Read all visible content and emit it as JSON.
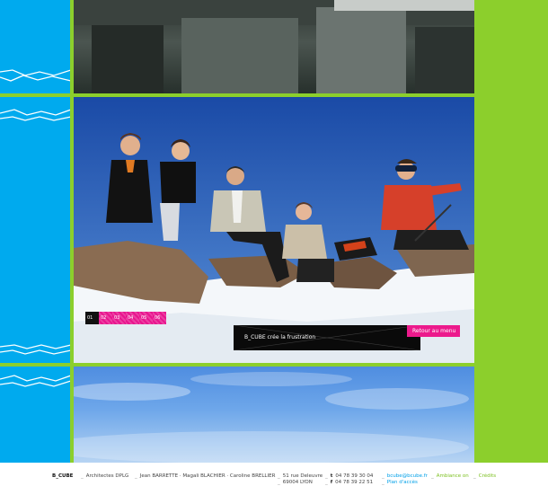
{
  "pager": {
    "pages": [
      "01",
      "02",
      "03",
      "04",
      "05",
      "06"
    ],
    "active_index": 0
  },
  "caption": {
    "text": "B_CUBE crée la frustration",
    "menu_button": "Retour au menu"
  },
  "footer": {
    "brand": "B_CUBE",
    "subtitle": "Architectes DPLG",
    "names": "Jean BARRETTE · Magali BLACHIER · Caroline BRELLIER",
    "address_line1": "51 rue Deleuvre",
    "address_line2": "69004 LYON",
    "phone_label": "t",
    "phone": "04 78 39 30 04",
    "fax_label": "f",
    "fax": "04 78 39 22 51",
    "email": "bcube@bcube.fr",
    "map_link": "Plan d'accès",
    "ambiance_link": "Ambiance on",
    "credits_link": "Crédits"
  },
  "colors": {
    "left_strip": "#00aaee",
    "right_strip": "#8ccf2c",
    "accent_pink": "#e8158e"
  }
}
